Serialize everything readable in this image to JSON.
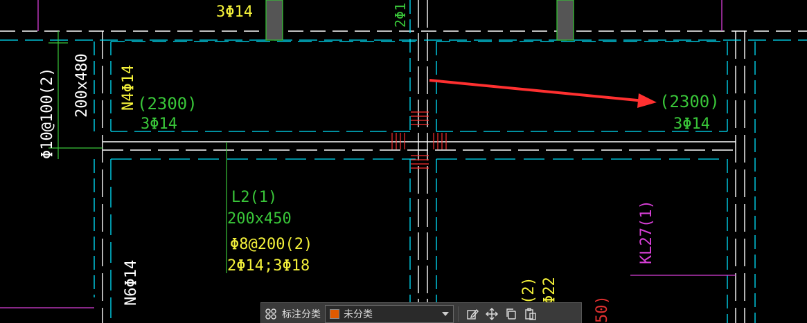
{
  "colors": {
    "background": "#000000",
    "wall": "#ffffff",
    "axis": "#00e5ff",
    "green_text": "#39c639",
    "yellow_text": "#f5f23a",
    "magenta_text": "#d83fd8",
    "red_text": "#e03030",
    "arrow": "#ff3030",
    "swatch": "#e05a00"
  },
  "annotations": {
    "top_label": "3Φ14",
    "left_size": "200x480",
    "left_stirrup": "Φ10@100(2)",
    "beam_mark": "N4Φ14",
    "beam_len_left": "(2300)",
    "beam_bars_left": "3Φ14",
    "beam_len_right": "(2300)",
    "beam_bars_right": "3Φ14",
    "top_center_partial": "2Φ1",
    "l2_name": "L2(1)",
    "l2_size": "200x450",
    "l2_stirrup": "Φ8@200(2)",
    "l2_bars": "2Φ14;3Φ18",
    "n6_mark": "N6Φ14",
    "kl27": "KL27(1)",
    "bottom_partial_a": "(2)",
    "bottom_partial_b": "Φ22",
    "bottom_partial_red": "50)"
  },
  "toolbar": {
    "layers_icon": "layers-icon",
    "category_label": "标注分类",
    "category_value": "未分类",
    "edit_icon": "edit-icon",
    "move_icon": "move-icon",
    "copy_icon": "copy-icon",
    "paste_icon": "paste-icon"
  }
}
